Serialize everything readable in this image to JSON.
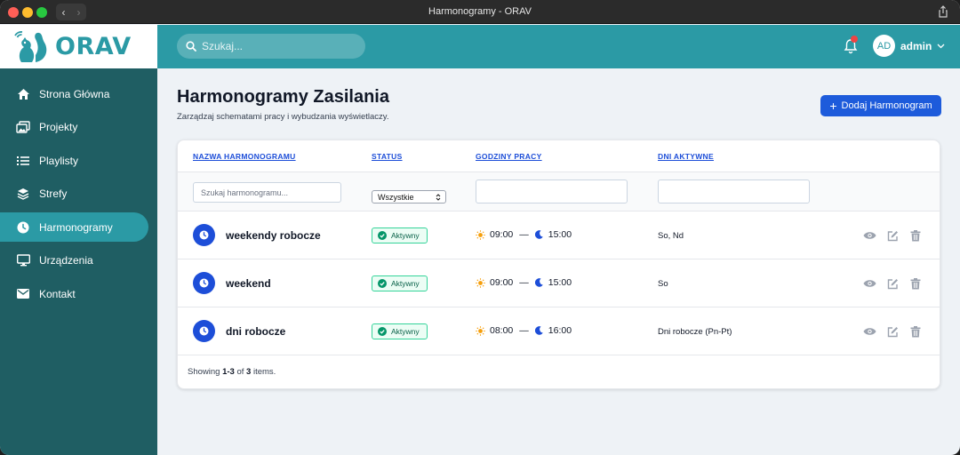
{
  "window": {
    "title": "Harmonogramy - ORAV"
  },
  "brand": {
    "name": "ORAV"
  },
  "sidebar": {
    "items": [
      {
        "label": "Strona Główna",
        "icon": "home-icon",
        "active": false
      },
      {
        "label": "Projekty",
        "icon": "images-icon",
        "active": false
      },
      {
        "label": "Playlisty",
        "icon": "list-icon",
        "active": false
      },
      {
        "label": "Strefy",
        "icon": "layers-icon",
        "active": false
      },
      {
        "label": "Harmonogramy",
        "icon": "clock-icon",
        "active": true
      },
      {
        "label": "Urządzenia",
        "icon": "monitor-icon",
        "active": false
      },
      {
        "label": "Kontakt",
        "icon": "envelope-icon",
        "active": false
      }
    ]
  },
  "topbar": {
    "search_placeholder": "Szukaj...",
    "user_initials": "AD",
    "user_name": "admin"
  },
  "page": {
    "title": "Harmonogramy Zasilania",
    "subtitle": "Zarządzaj schematami pracy i wybudzania wyświetlaczy.",
    "add_button": "Dodaj Harmonogram"
  },
  "table": {
    "headers": {
      "name": "NAZWA HARMONOGRAMU",
      "status": "STATUS",
      "hours": "GODZINY PRACY",
      "days": "DNI AKTYWNE"
    },
    "filters": {
      "name_placeholder": "Szukaj harmonogramu...",
      "status_value": "Wszystkie",
      "hours_value": "",
      "days_value": ""
    },
    "rows": [
      {
        "name": "weekendy robocze",
        "status": "Aktywny",
        "start": "09:00",
        "end": "15:00",
        "days": "So, Nd"
      },
      {
        "name": "weekend",
        "status": "Aktywny",
        "start": "09:00",
        "end": "15:00",
        "days": "So"
      },
      {
        "name": "dni robocze",
        "status": "Aktywny",
        "start": "08:00",
        "end": "16:00",
        "days": "Dni robocze (Pn-Pt)"
      }
    ],
    "separator": "—",
    "footer": {
      "prefix": "Showing ",
      "range": "1-3",
      "of": " of ",
      "total": "3",
      "suffix": " items."
    }
  },
  "colors": {
    "sidebar": "#1f5e63",
    "accent": "#2b9aa5",
    "primary": "#1d5bdb",
    "active_badge": "#34d399"
  }
}
